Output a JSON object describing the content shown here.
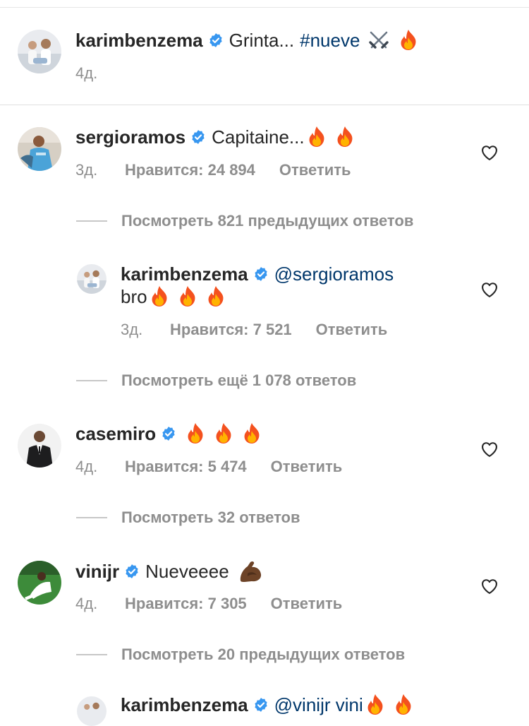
{
  "caption": {
    "username": "karimbenzema",
    "text": "Grinta...",
    "hashtag": "#nueve",
    "age": "4д."
  },
  "comments": [
    {
      "username": "sergioramos",
      "text": "Capitaine...",
      "age": "3д.",
      "likes": "Нравится: 24 894",
      "reply_label": "Ответить",
      "view_replies": "Посмотреть 821 предыдущих ответов"
    },
    {
      "username": "karimbenzema",
      "mention": "@sergioramos",
      "text": "bro",
      "age": "3д.",
      "likes": "Нравится: 7 521",
      "reply_label": "Ответить",
      "view_replies": "Посмотреть ещё 1 078 ответов"
    },
    {
      "username": "casemiro",
      "age": "4д.",
      "likes": "Нравится: 5 474",
      "reply_label": "Ответить",
      "view_replies": "Посмотреть 32 ответов"
    },
    {
      "username": "vinijr",
      "text": "Nueveeee",
      "age": "4д.",
      "likes": "Нравится: 7 305",
      "reply_label": "Ответить",
      "view_replies": "Посмотреть 20 предыдущих ответов"
    },
    {
      "username": "karimbenzema",
      "mention": "@vinijr vini"
    }
  ],
  "colors": {
    "text": "#262626",
    "secondary": "#8e8e8e",
    "link": "#00376b",
    "verified": "#3897f0"
  },
  "icons": [
    "verified-badge-icon",
    "heart-outline-icon",
    "fire-emoji",
    "crossed-swords-emoji",
    "flexed-biceps-emoji"
  ]
}
